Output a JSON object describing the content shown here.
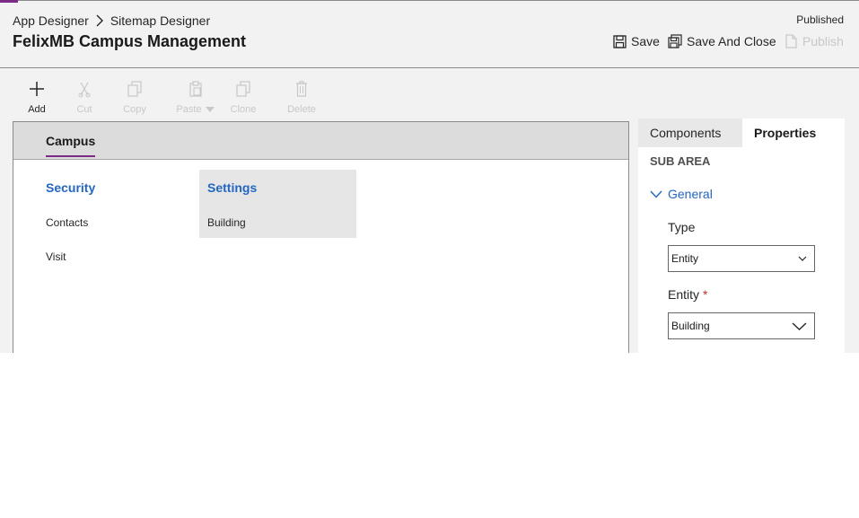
{
  "breadcrumb": {
    "app_designer": "App Designer",
    "sitemap_designer": "Sitemap Designer"
  },
  "page_title": "FelixMB Campus Management",
  "status": "Published",
  "commands": {
    "save": "Save",
    "save_and_close": "Save And Close",
    "publish": "Publish"
  },
  "toolbar": {
    "add": "Add",
    "cut": "Cut",
    "copy": "Copy",
    "paste": "Paste",
    "clone": "Clone",
    "delete": "Delete"
  },
  "canvas": {
    "area": "Campus",
    "groups": [
      {
        "title": "Security",
        "subareas": [
          "Contacts",
          "Visit"
        ]
      },
      {
        "title": "Settings",
        "subareas": [
          "Building"
        ]
      }
    ]
  },
  "panel": {
    "tabs": [
      "Components",
      "Properties"
    ],
    "section": "SUB AREA",
    "group": "General",
    "type_label": "Type",
    "type_value": "Entity",
    "entity_label": "Entity",
    "required_mark": "*",
    "entity_value": "Building"
  },
  "colors": {
    "accent": "#7b2b86",
    "link": "#2266c2",
    "required": "#c42f2f"
  }
}
